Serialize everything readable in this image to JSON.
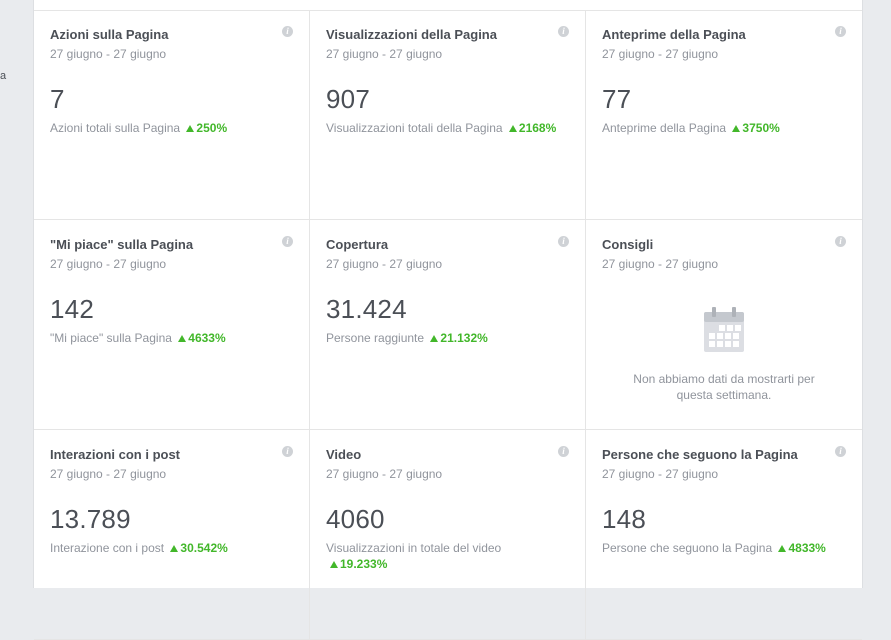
{
  "left_edge_text": "a",
  "cards": [
    {
      "title": "Azioni sulla Pagina",
      "dates": "27 giugno - 27 giugno",
      "value": "7",
      "sub": "Azioni totali sulla Pagina",
      "pct": "250%"
    },
    {
      "title": "Visualizzazioni della Pagina",
      "dates": "27 giugno - 27 giugno",
      "value": "907",
      "sub": "Visualizzazioni totali della Pagina",
      "pct": "2168%"
    },
    {
      "title": "Anteprime della Pagina",
      "dates": "27 giugno - 27 giugno",
      "value": "77",
      "sub": "Anteprime della Pagina",
      "pct": "3750%"
    },
    {
      "title": "\"Mi piace\" sulla Pagina",
      "dates": "27 giugno - 27 giugno",
      "value": "142",
      "sub": "\"Mi piace\" sulla Pagina",
      "pct": "4633%"
    },
    {
      "title": "Copertura",
      "dates": "27 giugno - 27 giugno",
      "value": "31.424",
      "sub": "Persone raggiunte",
      "pct": "21.132%"
    },
    {
      "title": "Consigli",
      "dates": "27 giugno - 27 giugno",
      "empty_message_line1": "Non abbiamo dati da mostrarti per",
      "empty_message_line2": "questa settimana."
    },
    {
      "title": "Interazioni con i post",
      "dates": "27 giugno - 27 giugno",
      "value": "13.789",
      "sub": "Interazione con i post",
      "pct": "30.542%"
    },
    {
      "title": "Video",
      "dates": "27 giugno - 27 giugno",
      "value": "4060",
      "sub": "Visualizzazioni in totale del video",
      "pct": "19.233%"
    },
    {
      "title": "Persone che seguono la Pagina",
      "dates": "27 giugno - 27 giugno",
      "value": "148",
      "sub": "Persone che seguono la Pagina",
      "pct": "4833%"
    }
  ],
  "info_icon_glyph": "i",
  "colors": {
    "increase": "#42b72a",
    "text_dark": "#4b4f56",
    "text_muted": "#90949c"
  },
  "icons": {
    "trend": "triangle-up-icon",
    "empty_state": "calendar-icon",
    "info": "info-icon"
  }
}
